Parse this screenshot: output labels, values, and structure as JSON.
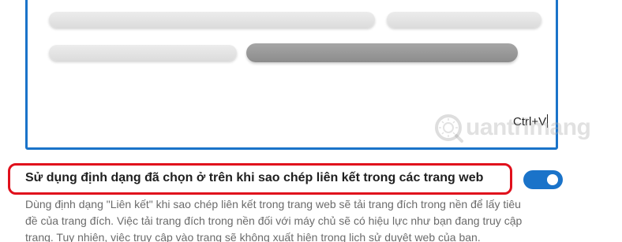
{
  "preview": {
    "shortcut_label": "Ctrl+V"
  },
  "watermark": {
    "text": "uantrimang"
  },
  "setting": {
    "label": "Sử dụng định dạng đã chọn ở trên khi sao chép liên kết trong các trang web",
    "toggle_state": "on",
    "description_lines": [
      "Dùng định dạng \"Liên kết\" khi sao chép liên kết trong trang web sẽ tải trang đích trong nền để lấy tiêu",
      "đề của trang đích. Việc tải trang đích trong nền đối với máy chủ sẽ có hiệu lực như bạn đang truy cập",
      "trang. Tuy nhiên, việc truy cập vào trang sẽ không xuất hiện trong lịch sử duyệt web của bạn."
    ]
  },
  "colors": {
    "accent": "#1a73c9",
    "highlight": "#e0101c",
    "description_text": "#6b6b6b"
  }
}
